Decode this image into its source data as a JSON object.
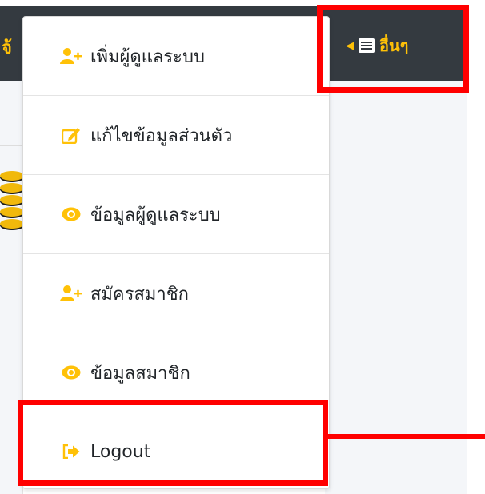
{
  "nav": {
    "partial_text": "จ้",
    "other_menu_label": "อื่นๆ"
  },
  "dropdown": {
    "items": [
      {
        "label": "เพิ่มผู้ดูแลระบบ",
        "icon": "user-plus-icon"
      },
      {
        "label": "แก้ไขข้อมูลส่วนตัว",
        "icon": "edit-icon"
      },
      {
        "label": "ข้อมูลผู้ดูแลระบบ",
        "icon": "eye-icon"
      },
      {
        "label": "สมัครสมาชิก",
        "icon": "user-plus-icon"
      },
      {
        "label": "ข้อมูลสมาชิก",
        "icon": "eye-icon"
      },
      {
        "label": "Logout",
        "icon": "sign-out-icon"
      }
    ]
  },
  "colors": {
    "nav_bg": "#343a40",
    "accent": "#ffc107",
    "highlight": "#ff0000"
  }
}
